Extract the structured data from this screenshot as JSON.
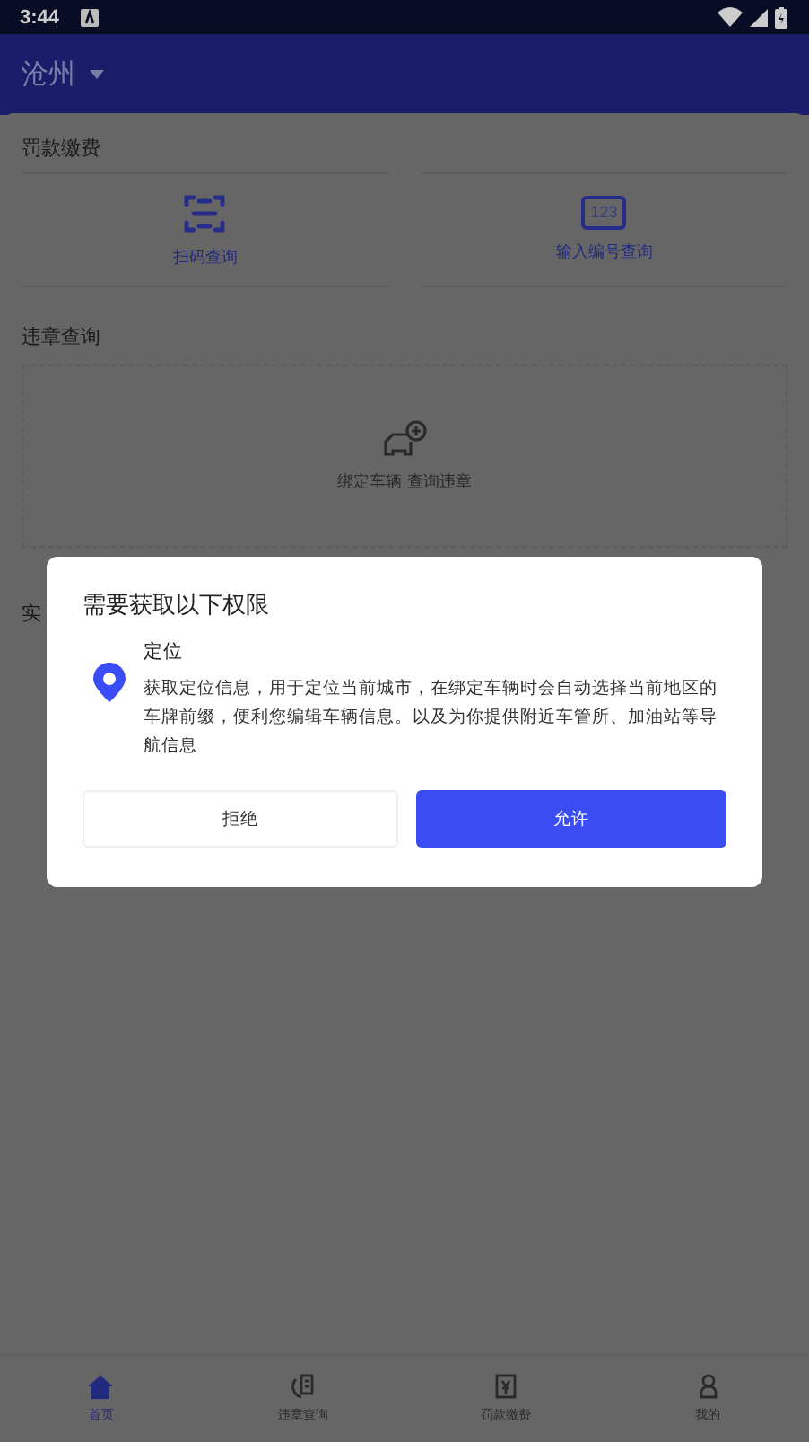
{
  "status_bar": {
    "time": "3:44"
  },
  "app_bar": {
    "city": "沧州"
  },
  "fine_section": {
    "title": "罚款缴费",
    "actions": [
      {
        "label": "扫码查询",
        "kind": "scan"
      },
      {
        "label": "输入编号查询",
        "kind": "number",
        "icon_text": "123"
      }
    ]
  },
  "violation_section": {
    "title": "违章查询",
    "prompt": "绑定车辆 查询违章"
  },
  "hidden_section": {
    "title": "实"
  },
  "dialog": {
    "title": "需要获取以下权限",
    "permission": {
      "name": "定位",
      "description": "获取定位信息，用于定位当前城市，在绑定车辆时会自动选择当前地区的车牌前缀，便利您编辑车辆信息。以及为你提供附近车管所、加油站等导航信息"
    },
    "buttons": [
      {
        "label": "拒绝",
        "kind": "secondary"
      },
      {
        "label": "允许",
        "kind": "primary"
      }
    ]
  },
  "bottom_nav": [
    {
      "label": "首页",
      "kind": "home",
      "selected": true
    },
    {
      "label": "违章查询",
      "kind": "violation",
      "selected": false
    },
    {
      "label": "罚款缴费",
      "kind": "fine",
      "selected": false
    },
    {
      "label": "我的",
      "kind": "me",
      "selected": false
    }
  ]
}
